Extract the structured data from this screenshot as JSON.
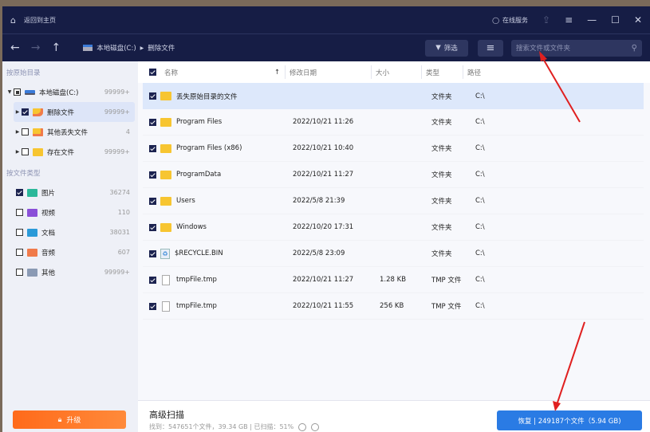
{
  "titlebar": {
    "home_label": "返回到主页",
    "online_service": "在线服务"
  },
  "toolbar": {
    "breadcrumb": [
      "本地磁盘(C:)",
      "删除文件"
    ],
    "filter_label": "筛选",
    "search_placeholder": "搜索文件或文件夹"
  },
  "sidebar": {
    "section_dir": "按原始目录",
    "dir_items": [
      {
        "label": "本地磁盘(C:)",
        "count": "99999+"
      },
      {
        "label": "删除文件",
        "count": "99999+"
      },
      {
        "label": "其他丢失文件",
        "count": "4"
      },
      {
        "label": "存在文件",
        "count": "99999+"
      }
    ],
    "section_type": "按文件类型",
    "type_items": [
      {
        "label": "图片",
        "count": "36274",
        "color": "#2bb89a"
      },
      {
        "label": "视频",
        "count": "110",
        "color": "#8a4fd8"
      },
      {
        "label": "文档",
        "count": "38031",
        "color": "#2a9ad8"
      },
      {
        "label": "音频",
        "count": "607",
        "color": "#f07a4a"
      },
      {
        "label": "其他",
        "count": "99999+",
        "color": "#8a9ab4"
      }
    ],
    "upgrade_label": "升级"
  },
  "table": {
    "headers": [
      "名称",
      "修改日期",
      "大小",
      "类型",
      "路径"
    ],
    "rows": [
      {
        "name": "丢失原始目录的文件",
        "date": "",
        "size": "",
        "type": "文件夹",
        "path": "C:\\"
      },
      {
        "name": "Program Files",
        "date": "2022/10/21 11:26",
        "size": "",
        "type": "文件夹",
        "path": "C:\\"
      },
      {
        "name": "Program Files (x86)",
        "date": "2022/10/21 10:40",
        "size": "",
        "type": "文件夹",
        "path": "C:\\"
      },
      {
        "name": "ProgramData",
        "date": "2022/10/21 11:27",
        "size": "",
        "type": "文件夹",
        "path": "C:\\"
      },
      {
        "name": "Users",
        "date": "2022/5/8 21:39",
        "size": "",
        "type": "文件夹",
        "path": "C:\\"
      },
      {
        "name": "Windows",
        "date": "2022/10/20 17:31",
        "size": "",
        "type": "文件夹",
        "path": "C:\\"
      },
      {
        "name": "$RECYCLE.BIN",
        "date": "2022/5/8 23:09",
        "size": "",
        "type": "文件夹",
        "path": "C:\\"
      },
      {
        "name": "tmpFile.tmp",
        "date": "2022/10/21 11:27",
        "size": "1.28 KB",
        "type": "TMP 文件",
        "path": "C:\\"
      },
      {
        "name": "tmpFile.tmp",
        "date": "2022/10/21 11:55",
        "size": "256 KB",
        "type": "TMP 文件",
        "path": "C:\\"
      }
    ]
  },
  "footer": {
    "title": "高级扫描",
    "stats": "找到：547651个文件，39.34 GB | 已扫描：51%",
    "recover_label": "恢复 | 249187个文件（5.94 GB)"
  }
}
